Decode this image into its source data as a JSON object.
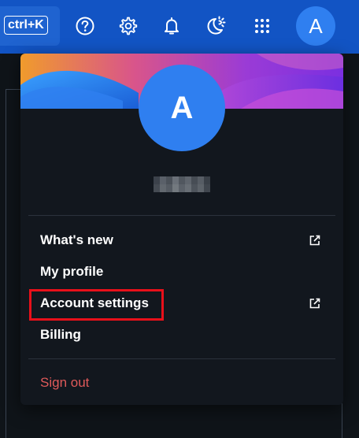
{
  "topbar": {
    "shortcut_label": "ctrl+K",
    "icons": [
      "help-icon",
      "gear-icon",
      "bell-icon",
      "theme-toggle-icon",
      "apps-grid-icon"
    ],
    "avatar_initial": "A",
    "background_color": "#1254c4"
  },
  "menu": {
    "avatar_initial": "A",
    "avatar_color": "#2f7ff0",
    "items": [
      {
        "label": "What's new",
        "external": true
      },
      {
        "label": "My profile",
        "external": false
      },
      {
        "label": "Account settings",
        "external": true
      },
      {
        "label": "Billing",
        "external": false
      }
    ],
    "sign_out_label": "Sign out",
    "sign_out_color": "#e05a5a"
  },
  "highlight_color": "#e8101a"
}
